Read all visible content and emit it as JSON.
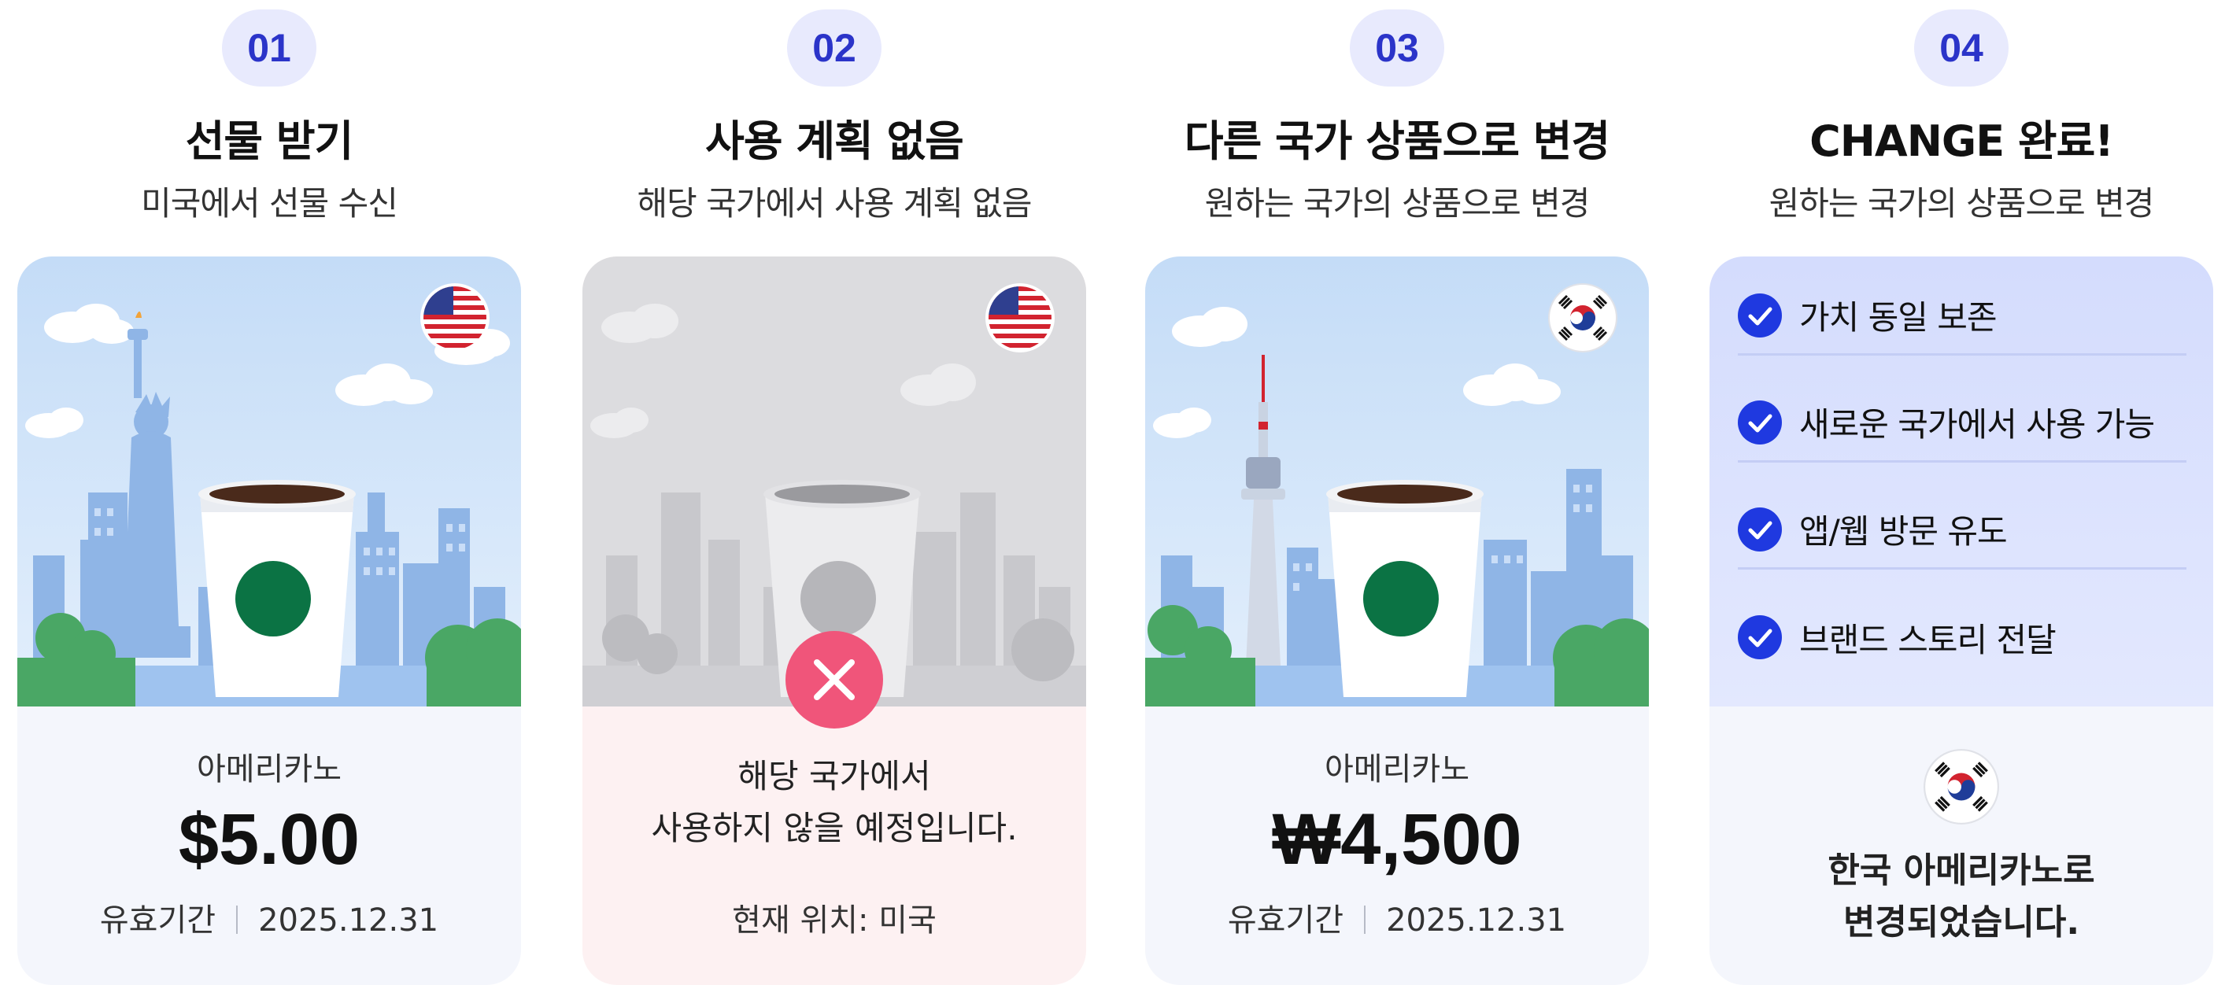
{
  "steps": [
    {
      "number": "01",
      "title": "선물 받기",
      "subtitle": "미국에서 선물 수신",
      "flag_icon": "us-flag-icon",
      "product_name": "아메리카노",
      "price": "$5.00",
      "validity_label": "유효기간",
      "validity_date": "2025.12.31"
    },
    {
      "number": "02",
      "title": "사용 계획 없음",
      "subtitle": "해당 국가에서 사용 계획 없음",
      "flag_icon": "us-flag-icon",
      "message_line1": "해당 국가에서",
      "message_line2": "사용하지 않을 예정입니다.",
      "location": "현재 위치: 미국"
    },
    {
      "number": "03",
      "title": "다른 국가 상품으로 변경",
      "subtitle": "원하는 국가의 상품으로 변경",
      "flag_icon": "korea-flag-icon",
      "product_name": "아메리카노",
      "price": "₩4,500",
      "validity_label": "유효기간",
      "validity_date": "2025.12.31"
    },
    {
      "number": "04",
      "title": "CHANGE 완료!",
      "subtitle": "원하는 국가의 상품으로 변경",
      "benefits": [
        "가치 동일 보존",
        "새로운 국가에서 사용 가능",
        "앱/웹 방문 유도",
        "브랜드 스토리 전달"
      ],
      "flag_icon": "korea-flag-icon",
      "result_line1": "한국 아메리카노로",
      "result_line2": "변경되었습니다."
    }
  ],
  "colors": {
    "badge_bg": "#e8eafd",
    "badge_text": "#2b34c9",
    "check_blue": "#1f39e0",
    "x_pink": "#f0557a",
    "cup_logo": "#0b7344"
  }
}
